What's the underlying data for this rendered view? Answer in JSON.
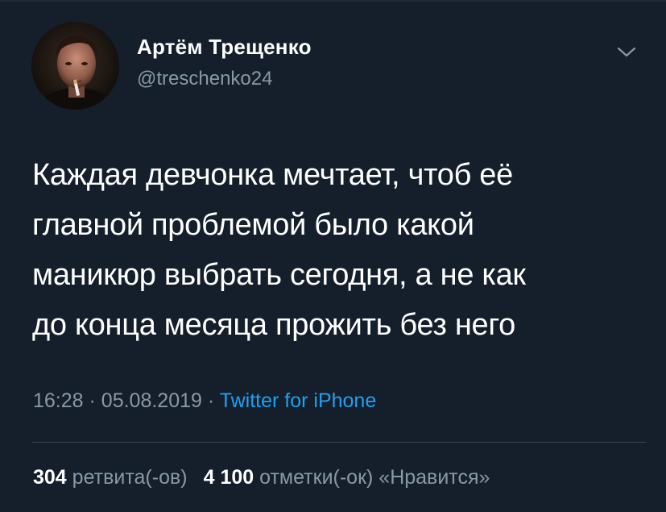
{
  "author": {
    "name": "Артём Трещенко",
    "handle": "@treschenko24"
  },
  "tweet": {
    "text_lines": [
      "Каждая девчонка мечтает, чтоб её",
      "главной проблемой было какой",
      "маникюр выбрать сегодня, а не как",
      "до конца месяца прожить без него"
    ],
    "time": "16:28",
    "separator": "·",
    "date": "05.08.2019",
    "source": "Twitter for iPhone"
  },
  "stats": {
    "retweets_count": "304",
    "retweets_label": "ретвита(-ов)",
    "likes_count": "4 100",
    "likes_label": "отметки(-ок) «Нравится»"
  },
  "colors": {
    "background": "#151f2b",
    "text": "#ffffff",
    "secondary": "#8899a6",
    "link": "#1da1f2",
    "divider": "#38444d"
  },
  "icons": {
    "menu": "chevron-down-icon"
  }
}
